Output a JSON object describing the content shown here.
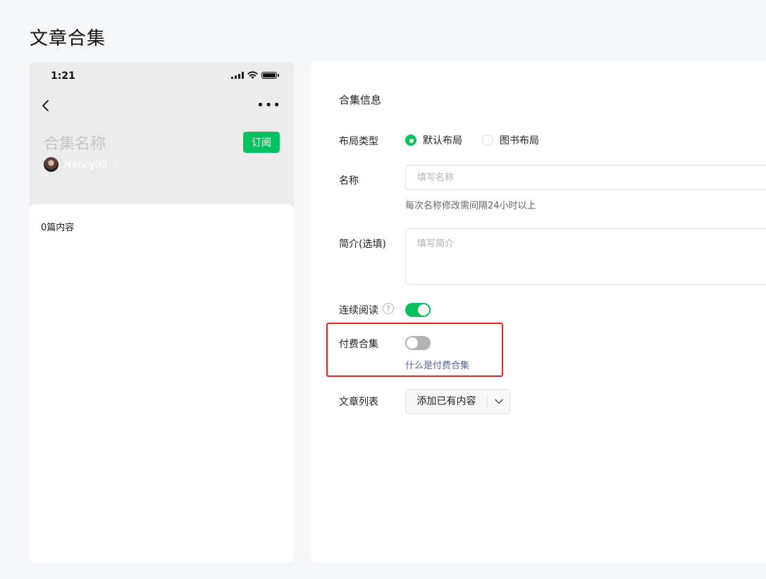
{
  "page": {
    "title": "文章合集"
  },
  "phone": {
    "status_time": "1:21",
    "collection_name_placeholder": "合集名称",
    "subscribe_label": "订阅",
    "author_name": "Nancy99",
    "author_chevron": "›",
    "more_glyph": "•••",
    "article_count": "0篇内容"
  },
  "form": {
    "section_title": "合集信息",
    "layout": {
      "label": "布局类型",
      "options": [
        {
          "label": "默认布局",
          "selected": true
        },
        {
          "label": "图书布局",
          "selected": false
        }
      ]
    },
    "name": {
      "label": "名称",
      "value": "",
      "placeholder": "填写名称",
      "hint": "每次名称修改需间隔24小时以上"
    },
    "intro": {
      "label": "简介(选填)",
      "value": "",
      "placeholder": "填写简介"
    },
    "continuous_reading": {
      "label": "连续阅读",
      "help_glyph": "?",
      "enabled": true
    },
    "paid_collection": {
      "label": "付费合集",
      "enabled": false,
      "link": "什么是付费合集"
    },
    "article_list": {
      "label": "文章列表",
      "dropdown_label": "添加已有内容"
    }
  },
  "colors": {
    "accent": "#07c160",
    "link": "#576b95",
    "highlight": "#e8251e"
  },
  "icons": [
    "back-icon",
    "more-icon",
    "signal-icon",
    "wifi-icon",
    "battery-icon",
    "help-icon",
    "chevron-down-icon"
  ]
}
